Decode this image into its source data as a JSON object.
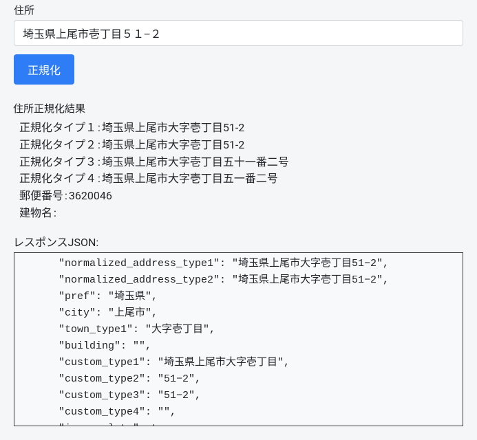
{
  "form": {
    "address_label": "住所",
    "address_value": "埼玉県上尾市壱丁目５１−２",
    "normalize_button": "正規化"
  },
  "results": {
    "heading": "住所正規化結果",
    "rows": [
      {
        "label": "正規化タイプ１",
        "value": "埼玉県上尾市大字壱丁目51-2"
      },
      {
        "label": "正規化タイプ２",
        "value": "埼玉県上尾市大字壱丁目51-2"
      },
      {
        "label": "正規化タイプ３",
        "value": "埼玉県上尾市大字壱丁目五十一番二号"
      },
      {
        "label": "正規化タイプ４",
        "value": "埼玉県上尾市大字壱丁目五一番二号"
      },
      {
        "label": "郵便番号",
        "value": "3620046"
      },
      {
        "label": "建物名",
        "value": ""
      }
    ]
  },
  "response_json": {
    "heading": "レスポンスJSON:",
    "lines": [
      "      \"normalized_address_type1\": \"埼玉県上尾市大字壱丁目51−2\",",
      "      \"normalized_address_type2\": \"埼玉県上尾市大字壱丁目51−2\",",
      "      \"pref\": \"埼玉県\",",
      "      \"city\": \"上尾市\",",
      "      \"town_type1\": \"大字壱丁目\",",
      "      \"building\": \"\",",
      "      \"custom_type1\": \"埼玉県上尾市大字壱丁目\",",
      "      \"custom_type2\": \"51−2\",",
      "      \"custom_type3\": \"51−2\",",
      "      \"custom_type4\": \"\",",
      "      \"is_complete\": true,"
    ]
  }
}
